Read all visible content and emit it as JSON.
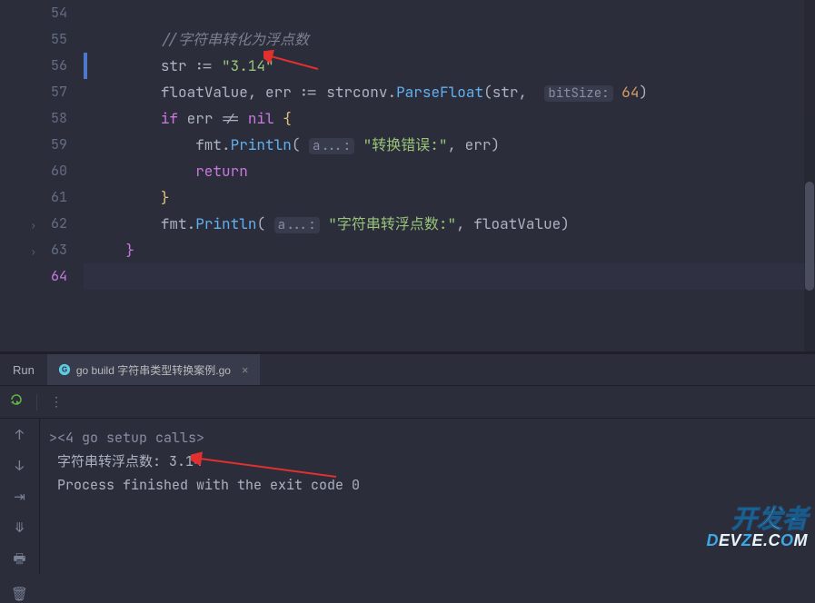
{
  "editor": {
    "lines": [
      {
        "num": "54",
        "tokens": [
          {
            "cls": "",
            "txt": ""
          }
        ]
      },
      {
        "num": "55",
        "tokens": [
          {
            "cls": "tok-comment",
            "txt": "//字符串转化为浮点数"
          }
        ],
        "indent": "        "
      },
      {
        "num": "56",
        "tokens": [
          {
            "cls": "tok-ident",
            "txt": "str "
          },
          {
            "cls": "tok-op",
            "txt": ":= "
          },
          {
            "cls": "tok-string",
            "txt": "\"3.14\""
          }
        ],
        "indent": "        ",
        "current": true
      },
      {
        "num": "57",
        "tokens": [
          {
            "cls": "tok-ident",
            "txt": "floatValue"
          },
          {
            "cls": "tok-op",
            "txt": ", "
          },
          {
            "cls": "tok-ident",
            "txt": "err "
          },
          {
            "cls": "tok-op",
            "txt": ":= "
          },
          {
            "cls": "tok-ident",
            "txt": "strconv"
          },
          {
            "cls": "tok-op",
            "txt": "."
          },
          {
            "cls": "tok-func",
            "txt": "ParseFloat"
          },
          {
            "cls": "tok-paren",
            "txt": "("
          },
          {
            "cls": "tok-ident",
            "txt": "str"
          },
          {
            "cls": "tok-op",
            "txt": ",  "
          },
          {
            "cls": "tok-hint",
            "txt": "bitSize:"
          },
          {
            "cls": "",
            "txt": " "
          },
          {
            "cls": "tok-number",
            "txt": "64"
          },
          {
            "cls": "tok-paren",
            "txt": ")"
          }
        ],
        "indent": "        "
      },
      {
        "num": "58",
        "tokens": [
          {
            "cls": "tok-keyword",
            "txt": "if "
          },
          {
            "cls": "tok-ident",
            "txt": "err "
          },
          {
            "cls": "tok-op",
            "txt": "!= "
          },
          {
            "cls": "tok-keyword",
            "txt": "nil "
          },
          {
            "cls": "tok-brace",
            "txt": "{"
          }
        ],
        "indent": "        "
      },
      {
        "num": "59",
        "tokens": [
          {
            "cls": "tok-ident",
            "txt": "fmt"
          },
          {
            "cls": "tok-op",
            "txt": "."
          },
          {
            "cls": "tok-func",
            "txt": "Println"
          },
          {
            "cls": "tok-paren",
            "txt": "( "
          },
          {
            "cls": "tok-hint",
            "txt": "a...:"
          },
          {
            "cls": "",
            "txt": " "
          },
          {
            "cls": "tok-string",
            "txt": "\"转换错误:\""
          },
          {
            "cls": "tok-op",
            "txt": ", "
          },
          {
            "cls": "tok-ident",
            "txt": "err"
          },
          {
            "cls": "tok-paren",
            "txt": ")"
          }
        ],
        "indent": "            "
      },
      {
        "num": "60",
        "tokens": [
          {
            "cls": "tok-keyword",
            "txt": "return"
          }
        ],
        "indent": "            "
      },
      {
        "num": "61",
        "tokens": [
          {
            "cls": "tok-brace",
            "txt": "}"
          }
        ],
        "indent": "        "
      },
      {
        "num": "62",
        "tokens": [
          {
            "cls": "tok-ident",
            "txt": "fmt"
          },
          {
            "cls": "tok-op",
            "txt": "."
          },
          {
            "cls": "tok-func",
            "txt": "Println"
          },
          {
            "cls": "tok-paren",
            "txt": "( "
          },
          {
            "cls": "tok-hint",
            "txt": "a...:"
          },
          {
            "cls": "",
            "txt": " "
          },
          {
            "cls": "tok-string",
            "txt": "\"字符串转浮点数:\""
          },
          {
            "cls": "tok-op",
            "txt": ", "
          },
          {
            "cls": "tok-ident",
            "txt": "floatValue"
          },
          {
            "cls": "tok-paren",
            "txt": ")"
          }
        ],
        "indent": "        "
      },
      {
        "num": "63",
        "tokens": [
          {
            "cls": "tok-brace2",
            "txt": "}"
          }
        ],
        "indent": "    "
      },
      {
        "num": "64",
        "tokens": [],
        "indent": "",
        "last": true
      }
    ]
  },
  "run": {
    "tab_label": "Run",
    "build_tab": "go build 字符串类型转换案例.go",
    "console_lines": [
      {
        "cls": "console-fold",
        "txt": "><4 go setup calls>"
      },
      {
        "cls": "",
        "txt": " 字符串转浮点数: 3.14"
      },
      {
        "cls": "",
        "txt": ""
      },
      {
        "cls": "",
        "txt": " Process finished with the exit code 0"
      }
    ]
  },
  "watermark": {
    "top_a": "开",
    "top_b": "发",
    "top_c": "者",
    "bot_a": "D",
    "bot_b": "EV",
    "bot_c": "Z",
    "bot_d": "E.C",
    "bot_e": "O",
    "bot_f": "M"
  }
}
